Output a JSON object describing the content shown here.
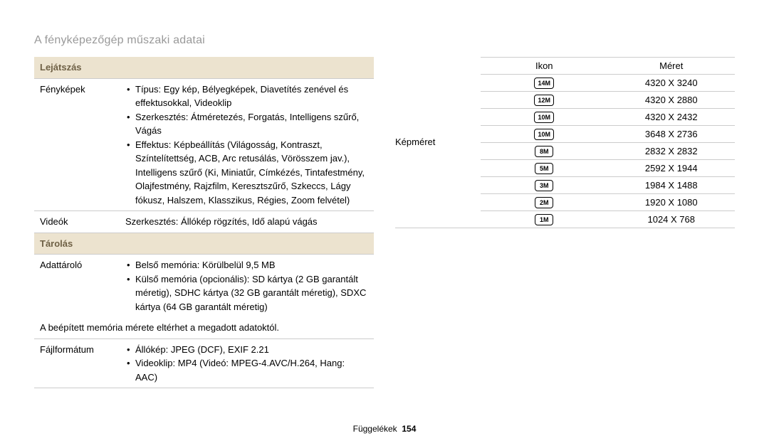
{
  "header": {
    "title": "A fényképezőgép műszaki adatai"
  },
  "left": {
    "section_playback": "Lejátszás",
    "photos_label": "Fényképek",
    "photos_b1": "Típus: Egy kép, Bélyegképek, Diavetítés zenével és effektusokkal, Videoklip",
    "photos_b2": "Szerkesztés: Átméretezés, Forgatás, Intelligens szűrő, Vágás",
    "photos_b3": "Effektus: Képbeállítás (Világosság, Kontraszt, Színtelítettség, ACB, Arc retusálás, Vörösszem jav.), Intelligens szűrő (Ki, Miniatűr, Címkézés, Tintafestmény, Olajfestmény, Rajzfilm, Keresztszűrő, Szkeccs, Lágy fókusz, Halszem, Klasszikus, Régies, Zoom felvétel)",
    "videos_label": "Videók",
    "videos_val": "Szerkesztés: Állókép rögzítés, Idő alapú vágás",
    "section_storage": "Tárolás",
    "storage_label": "Adattároló",
    "storage_b1": "Belső memória: Körülbelül 9,5 MB",
    "storage_b2": "Külső memória (opcionális): SD kártya (2 GB garantált méretig), SDHC kártya (32 GB garantált méretig), SDXC kártya (64 GB garantált méretig)",
    "storage_note": "A beépített memória mérete eltérhet a megadott adatoktól.",
    "format_label": "Fájlformátum",
    "format_b1": "Állókép: JPEG (DCF), EXIF 2.21",
    "format_b2": "Videoklip: MP4 (Videó: MPEG-4.AVC/H.264, Hang: AAC)"
  },
  "right": {
    "label": "Képméret",
    "th_icon": "Ikon",
    "th_size": "Méret",
    "rows": [
      {
        "icon": "14M",
        "size": "4320 X 3240"
      },
      {
        "icon": "12M",
        "size": "4320 X 2880"
      },
      {
        "icon": "10M",
        "size": "4320 X 2432"
      },
      {
        "icon": "10M",
        "size": "3648 X 2736"
      },
      {
        "icon": "8M",
        "size": "2832 X 2832"
      },
      {
        "icon": "5M",
        "size": "2592 X 1944"
      },
      {
        "icon": "3M",
        "size": "1984 X 1488"
      },
      {
        "icon": "2M",
        "size": "1920 X 1080"
      },
      {
        "icon": "1M",
        "size": "1024 X 768"
      }
    ]
  },
  "footer": {
    "label": "Függelékek",
    "page": "154"
  }
}
